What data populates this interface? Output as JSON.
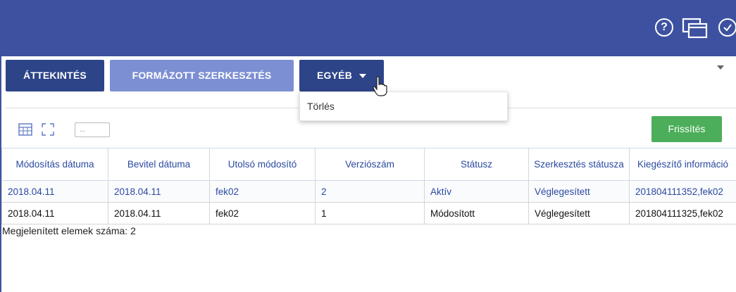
{
  "header": {
    "help_icon_glyph": "?",
    "icons": [
      "help-icon",
      "windows-icon",
      "check-circle-icon"
    ]
  },
  "toolbar": {
    "overview_label": "ÁTTEKINTÉS",
    "formatted_edit_label": "FORMÁZOTT SZERKESZTÉS",
    "other_label": "EGYÉB"
  },
  "dropdown": {
    "items": [
      {
        "label": "Törlés"
      }
    ]
  },
  "grid_tools": {
    "select_value": "..."
  },
  "refresh_label": "Frissítés",
  "table": {
    "columns": [
      "Módosítás dátuma",
      "Bevitel dátuma",
      "Utolsó módosító",
      "Verziószám",
      "Státusz",
      "Szerkesztés státusza",
      "Kiegészítő információ"
    ],
    "rows": [
      [
        "2018.04.11",
        "2018.04.11",
        "fek02",
        "2",
        "Aktív",
        "Véglegesített",
        "201804111352,fek02"
      ],
      [
        "2018.04.11",
        "2018.04.11",
        "fek02",
        "1",
        "Módosított",
        "Véglegesített",
        "201804111325,fek02"
      ]
    ]
  },
  "footer": {
    "count_label": "Megjelenített elemek száma: 2"
  },
  "colors": {
    "header_bg": "#3d51a0",
    "primary_button": "#2e4489",
    "secondary_button": "#7d8fd3",
    "refresh_button": "#4cae5a",
    "link_text": "#2a4aa1"
  }
}
